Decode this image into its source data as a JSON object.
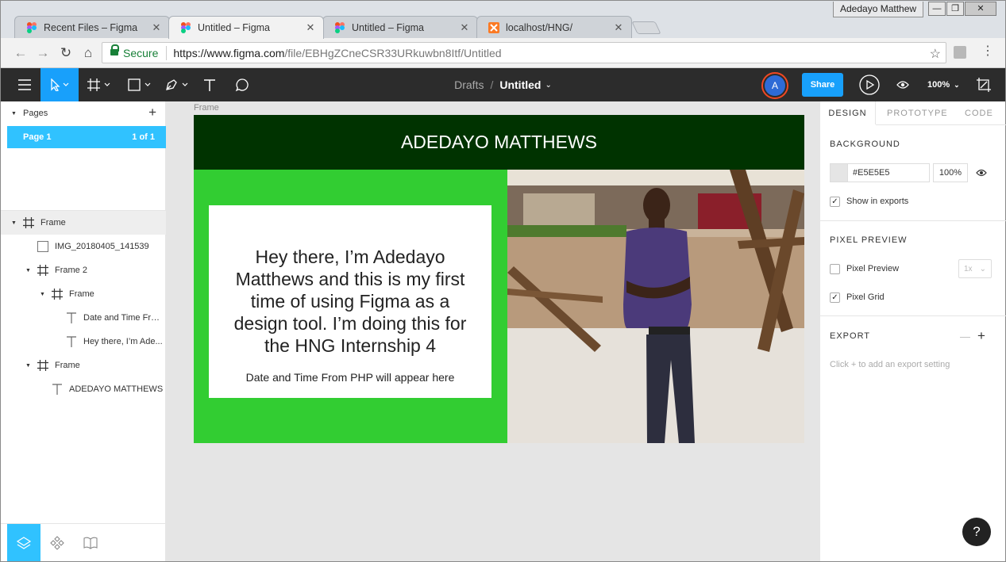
{
  "browser": {
    "tabs": [
      {
        "title": "Recent Files – Figma",
        "favicon": "figma-icon"
      },
      {
        "title": "Untitled – Figma",
        "favicon": "figma-icon"
      },
      {
        "title": "Untitled – Figma",
        "favicon": "figma-icon"
      },
      {
        "title": "localhost/HNG/",
        "favicon": "xampp-icon"
      }
    ],
    "profile_name": "Adedayo Matthew",
    "secure_label": "Secure",
    "url_host": "https://www.figma.com",
    "url_path": "/file/EBHgZCneCSR33URkuwbn8Itf/Untitled"
  },
  "figma_toolbar": {
    "breadcrumb_parent": "Drafts",
    "breadcrumb_sep": "/",
    "file_title": "Untitled",
    "avatar_letter": "A",
    "share_label": "Share",
    "zoom_label": "100%"
  },
  "left_panel": {
    "pages_label": "Pages",
    "page_name": "Page 1",
    "page_count": "1 of 1",
    "layers": [
      {
        "name": "Frame",
        "type": "frame"
      },
      {
        "name": "IMG_20180405_141539",
        "type": "image"
      },
      {
        "name": "Frame 2",
        "type": "frame"
      },
      {
        "name": "Frame",
        "type": "frame"
      },
      {
        "name": "Date and Time Fro...",
        "type": "text"
      },
      {
        "name": "Hey there, I’m Ade...",
        "type": "text"
      },
      {
        "name": "Frame",
        "type": "frame"
      },
      {
        "name": "ADEDAYO MATTHEWS",
        "type": "text"
      }
    ]
  },
  "canvas": {
    "frame_label": "Frame",
    "header_title": "ADEDAYO MATTHEWS",
    "card_text": "Hey there, I’m Adedayo Matthews and this is my first time of using Figma as a design tool. I’m doing this for the HNG Internship 4",
    "card_date": "Date and Time From PHP will appear here",
    "colors": {
      "header": "#003300",
      "green": "#32cd32",
      "card": "#ffffff"
    }
  },
  "right_panel": {
    "tabs": [
      "DESIGN",
      "PROTOTYPE",
      "CODE"
    ],
    "background_title": "BACKGROUND",
    "bg_hex": "#E5E5E5",
    "bg_opacity": "100%",
    "show_in_exports": "Show in exports",
    "pixel_preview_title": "PIXEL PREVIEW",
    "pixel_preview_label": "Pixel Preview",
    "pixel_preview_scale": "1x",
    "pixel_grid_label": "Pixel Grid",
    "export_title": "EXPORT",
    "export_hint": "Click + to add an export setting",
    "help_label": "?"
  }
}
